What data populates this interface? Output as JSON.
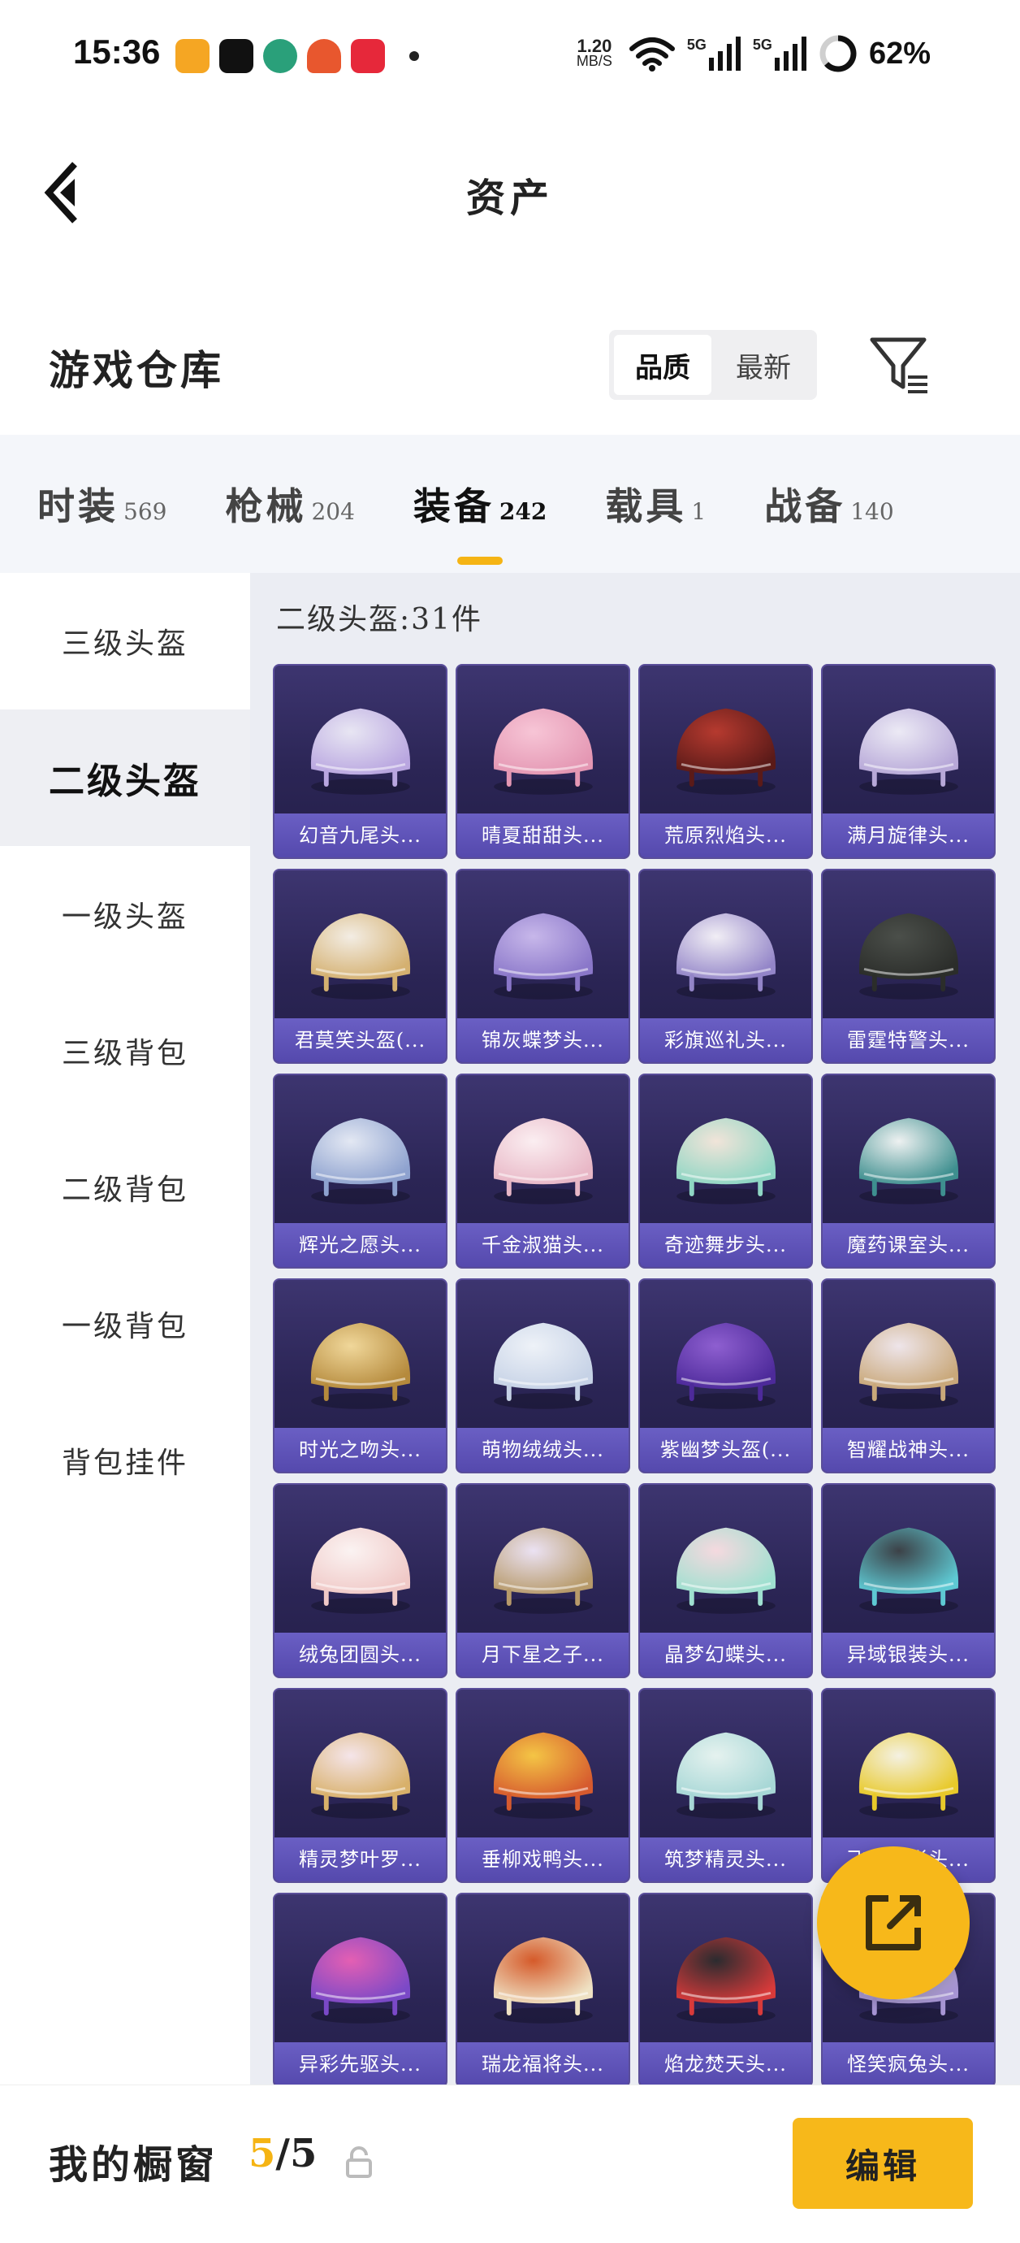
{
  "status_bar": {
    "time": "15:36",
    "net_speed": "1.20",
    "net_unit": "MB/S",
    "signal_a": "5G",
    "signal_b": "5G",
    "battery": "62%"
  },
  "header": {
    "title": "资产"
  },
  "section": {
    "title": "游戏仓库",
    "sort_options": [
      "品质",
      "最新"
    ],
    "sort_selected": "品质"
  },
  "tabs": [
    {
      "label": "时装",
      "count": "569"
    },
    {
      "label": "枪械",
      "count": "204"
    },
    {
      "label": "装备",
      "count": "242",
      "active": true
    },
    {
      "label": "载具",
      "count": "1"
    },
    {
      "label": "战备",
      "count": "140"
    }
  ],
  "sidebar": {
    "items": [
      {
        "label": "三级头盔"
      },
      {
        "label": "二级头盔",
        "active": true
      },
      {
        "label": "一级头盔"
      },
      {
        "label": "三级背包"
      },
      {
        "label": "二级背包"
      },
      {
        "label": "一级背包"
      },
      {
        "label": "背包挂件"
      }
    ]
  },
  "content": {
    "heading": "二级头盔:31件",
    "items": [
      {
        "name": "幻音九尾头...",
        "c1": "#e8e6f3",
        "c2": "#b9a6e0"
      },
      {
        "name": "晴夏甜甜头...",
        "c1": "#f7c5d6",
        "c2": "#e497b3"
      },
      {
        "name": "荒原烈焰头...",
        "c1": "#b63a2f",
        "c2": "#5a1a18"
      },
      {
        "name": "满月旋律头...",
        "c1": "#eceaf5",
        "c2": "#b7a8d8"
      },
      {
        "name": "君莫笑头盔(...",
        "c1": "#f3ede4",
        "c2": "#d4b070"
      },
      {
        "name": "锦灰蝶梦头...",
        "c1": "#c7b7ea",
        "c2": "#8a77c9"
      },
      {
        "name": "彩旗巡礼头...",
        "c1": "#f1eef5",
        "c2": "#9385c8"
      },
      {
        "name": "雷霆特警头...",
        "c1": "#4b4f4a",
        "c2": "#2b2d2a"
      },
      {
        "name": "辉光之愿头...",
        "c1": "#e3e8f3",
        "c2": "#8ea2cf"
      },
      {
        "name": "千金淑猫头...",
        "c1": "#fbeef1",
        "c2": "#e8b7c6"
      },
      {
        "name": "奇迹舞步头...",
        "c1": "#f1e4d9",
        "c2": "#8fd6c4"
      },
      {
        "name": "魔药课室头...",
        "c1": "#eef1f1",
        "c2": "#3e8f8f"
      },
      {
        "name": "时光之吻头...",
        "c1": "#f0d79a",
        "c2": "#b58a3c"
      },
      {
        "name": "萌物绒绒头...",
        "c1": "#eef2f8",
        "c2": "#c6d2e6"
      },
      {
        "name": "紫幽梦头盔(...",
        "c1": "#8e5fd0",
        "c2": "#4d2a9a"
      },
      {
        "name": "智耀战神头...",
        "c1": "#eee5ea",
        "c2": "#c9a87a"
      },
      {
        "name": "绒兔团圆头...",
        "c1": "#fbf3f2",
        "c2": "#f0c9c7"
      },
      {
        "name": "月下星之子...",
        "c1": "#ebe2f3",
        "c2": "#b79a6a"
      },
      {
        "name": "晶梦幻蝶头...",
        "c1": "#f5d9df",
        "c2": "#9fe0d0"
      },
      {
        "name": "异域银装头...",
        "c1": "#3c4147",
        "c2": "#5ec9d3"
      },
      {
        "name": "精灵梦叶罗...",
        "c1": "#f5e5ea",
        "c2": "#d8b06a"
      },
      {
        "name": "垂柳戏鸭头...",
        "c1": "#f4c545",
        "c2": "#d65a2e"
      },
      {
        "name": "筑梦精灵头...",
        "c1": "#e5f2ef",
        "c2": "#a7d7d6"
      },
      {
        "name": "飞跃流影头...",
        "c1": "#f4f1e2",
        "c2": "#e8c92a"
      },
      {
        "name": "异彩先驱头...",
        "c1": "#e45fb3",
        "c2": "#7a49c7"
      },
      {
        "name": "瑞龙福将头...",
        "c1": "#d55a2a",
        "c2": "#efe2c4"
      },
      {
        "name": "焰龙焚天头...",
        "c1": "#2b2b2f",
        "c2": "#d83a3a"
      },
      {
        "name": "怪笑疯兔头...",
        "c1": "#eee9f5",
        "c2": "#a795d4"
      }
    ]
  },
  "bottom_bar": {
    "title": "我的橱窗",
    "count_current": "5",
    "count_total": "/5",
    "edit_label": "编辑"
  },
  "colors": {
    "accent": "#f7b81a",
    "card_bg": "#2b2555",
    "card_label_bg": "#5a4eb0"
  }
}
